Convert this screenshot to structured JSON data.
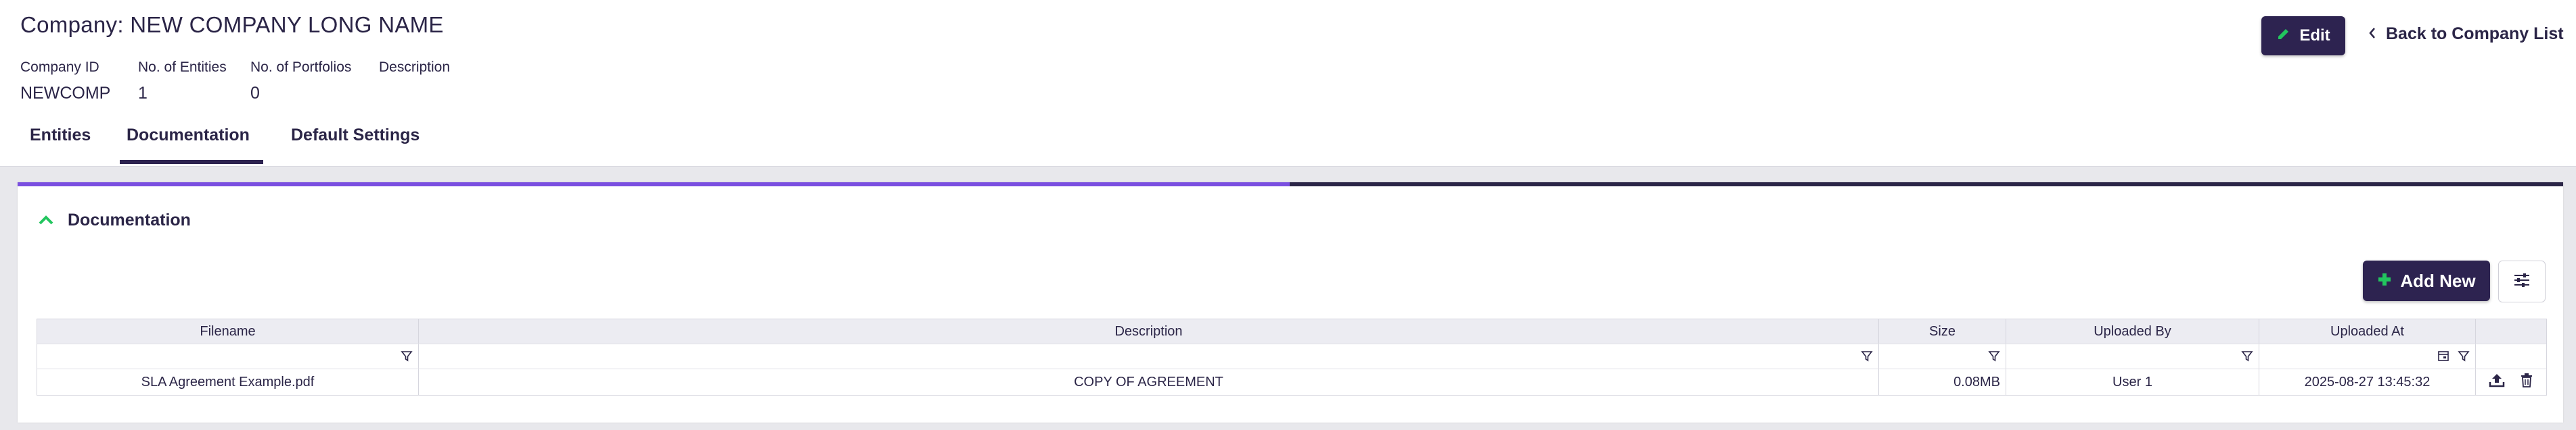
{
  "header": {
    "title": "Company: NEW COMPANY LONG NAME",
    "meta": [
      {
        "label": "Company ID",
        "value": "NEWCOMP"
      },
      {
        "label": "No. of Entities",
        "value": "1"
      },
      {
        "label": "No. of Portfolios",
        "value": "0"
      },
      {
        "label": "Description",
        "value": ""
      }
    ],
    "edit_label": "Edit",
    "back_label": "Back to Company List"
  },
  "tabs": [
    {
      "label": "Entities",
      "active": false
    },
    {
      "label": "Documentation",
      "active": true
    },
    {
      "label": "Default Settings",
      "active": false
    }
  ],
  "section": {
    "title": "Documentation",
    "add_new_label": "Add New"
  },
  "grid": {
    "columns": [
      "Filename",
      "Description",
      "Size",
      "Uploaded By",
      "Uploaded At"
    ],
    "rows": [
      {
        "filename": "SLA Agreement Example.pdf",
        "description": "COPY OF AGREEMENT",
        "size": "0.08MB",
        "uploaded_by": "User 1",
        "uploaded_at": "2025-08-27 13:45:32"
      }
    ]
  },
  "colors": {
    "primary": "#2d2350",
    "accent_green": "#22c55e",
    "accent_purple": "#7a4fe0"
  },
  "icons": {
    "edit": "pencil-icon",
    "back": "chevron-left-icon",
    "collapse": "chevron-up-icon",
    "add": "plus-icon",
    "settings": "sliders-icon",
    "filter": "filter-icon",
    "calendar": "calendar-icon",
    "upload": "upload-icon",
    "delete": "trash-icon"
  }
}
